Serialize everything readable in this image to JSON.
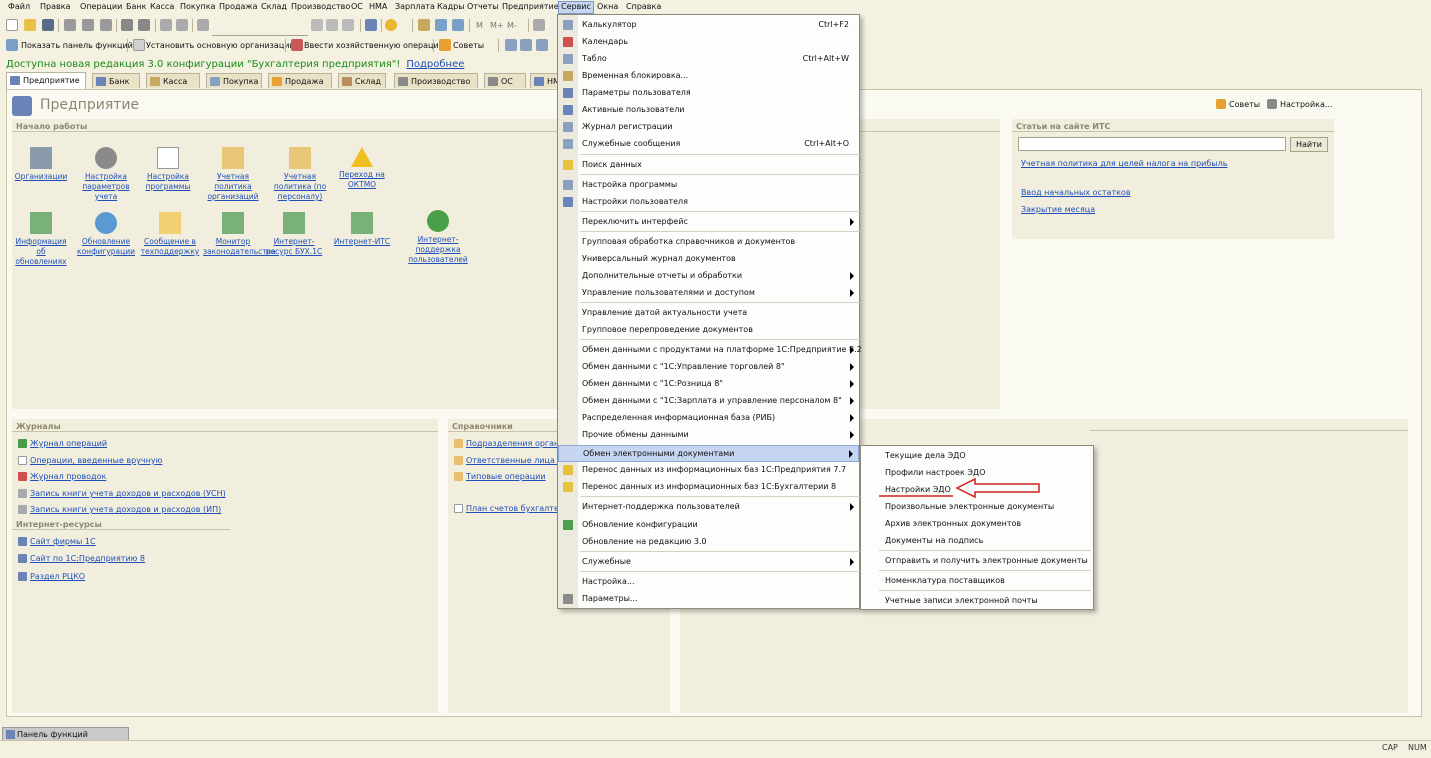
{
  "menubar": [
    "Файл",
    "Правка",
    "Операции",
    "Банк",
    "Касса",
    "Покупка",
    "Продажа",
    "Склад",
    "Производство",
    "ОС",
    "НМА",
    "Зарплата",
    "Кадры",
    "Отчеты",
    "Предприятие",
    "Сервис",
    "Окна",
    "Справка"
  ],
  "toolbar2": {
    "show_panel": "Показать панель функций",
    "set_org": "Установить основную организацию",
    "enter_op": "Ввести хозяйственную операцию",
    "tips": "Советы"
  },
  "notice": {
    "text": "Доступна новая редакция 3.0 конфигурации \"Бухгалтерия предприятия\"!",
    "link": "Подробнее"
  },
  "tabs": [
    "Предприятие",
    "Банк",
    "Касса",
    "Покупка",
    "Продажа",
    "Склад",
    "Производство",
    "ОС",
    "НМА"
  ],
  "page_title": "Предприятие",
  "header_links": {
    "tips": "Советы",
    "settings": "Настройка..."
  },
  "start": {
    "title": "Начало работы",
    "row1": [
      "Организации",
      "Настройка параметров учета",
      "Настройка программы",
      "Учетная политика организаций",
      "Учетная политика (по персоналу)",
      "Переход на ОКТМО"
    ],
    "row2": [
      "Информация об обновлениях",
      "Обновление конфигурации",
      "Сообщение в техподдержку",
      "Монитор законодательства",
      "Интернет-ресурс БУХ.1С",
      "Интернет-ИТС",
      "Интернет-поддержка пользователей"
    ]
  },
  "its": {
    "title": "Статьи на сайте ИТС",
    "button": "Найти",
    "links": [
      "Учетная политика для целей налога на прибыль",
      "Ввод начальных остатков",
      "Закрытие месяца"
    ]
  },
  "journals": {
    "title": "Журналы",
    "items": [
      "Журнал операций",
      "Операции, введенные вручную",
      "Журнал проводок",
      "Запись книги учета доходов и расходов (УСН)",
      "Запись книги учета доходов и расходов (ИП)"
    ]
  },
  "internet": {
    "title": "Интернет-ресурсы",
    "items": [
      "Сайт фирмы 1С",
      "Сайт по 1С:Предприятию 8",
      "Раздел РЦКО"
    ]
  },
  "refs": {
    "title": "Справочники",
    "items": [
      "Подразделения органи",
      "Ответственные лица ор",
      "Типовые операции",
      "План счетов бухгалтер"
    ]
  },
  "service_menu": [
    {
      "label": "Калькулятор",
      "shortcut": "Ctrl+F2"
    },
    {
      "label": "Календарь"
    },
    {
      "label": "Табло",
      "shortcut": "Ctrl+Alt+W"
    },
    {
      "label": "Временная блокировка..."
    },
    {
      "label": "Параметры пользователя"
    },
    {
      "label": "Активные пользователи"
    },
    {
      "label": "Журнал регистрации"
    },
    {
      "label": "Служебные сообщения",
      "shortcut": "Ctrl+Alt+O"
    },
    {
      "label": "Поиск данных"
    },
    {
      "label": "Настройка программы"
    },
    {
      "label": "Настройки пользователя"
    },
    {
      "label": "Переключить интерфейс"
    },
    {
      "label": "Групповая обработка справочников и документов"
    },
    {
      "label": "Универсальный журнал документов"
    },
    {
      "label": "Дополнительные отчеты и обработки"
    },
    {
      "label": "Управление пользователями и доступом"
    },
    {
      "label": "Управление датой актуальности учета"
    },
    {
      "label": "Групповое перепроведение документов"
    },
    {
      "label": "Обмен данными с продуктами на платформе 1С:Предприятие 8.2"
    },
    {
      "label": "Обмен данными с \"1С:Управление торговлей 8\""
    },
    {
      "label": "Обмен данными с \"1С:Розница 8\""
    },
    {
      "label": "Обмен данными с \"1С:Зарплата и управление персоналом 8\""
    },
    {
      "label": "Распределенная информационная база (РИБ)"
    },
    {
      "label": "Прочие обмены данными"
    },
    {
      "label": "Обмен электронными документами"
    },
    {
      "label": "Перенос данных из информационных баз 1С:Предприятия 7.7"
    },
    {
      "label": "Перенос данных из информационных баз 1С:Бухгалтерии 8"
    },
    {
      "label": "Интернет-поддержка пользователей"
    },
    {
      "label": "Обновление конфигурации"
    },
    {
      "label": "Обновление на редакцию 3.0"
    },
    {
      "label": "Служебные"
    },
    {
      "label": "Настройка..."
    },
    {
      "label": "Параметры..."
    }
  ],
  "edo_submenu": [
    "Текущие дела ЭДО",
    "Профили настроек ЭДО",
    "Настройки ЭДО",
    "Произвольные электронные документы",
    "Архив электронных документов",
    "Документы на подпись",
    "Отправить и получить электронные документы",
    "Номенклатура поставщиков",
    "Учетные записи электронной почты"
  ],
  "taskbar": "Панель функций",
  "status": {
    "cap": "CAP",
    "num": "NUM"
  }
}
